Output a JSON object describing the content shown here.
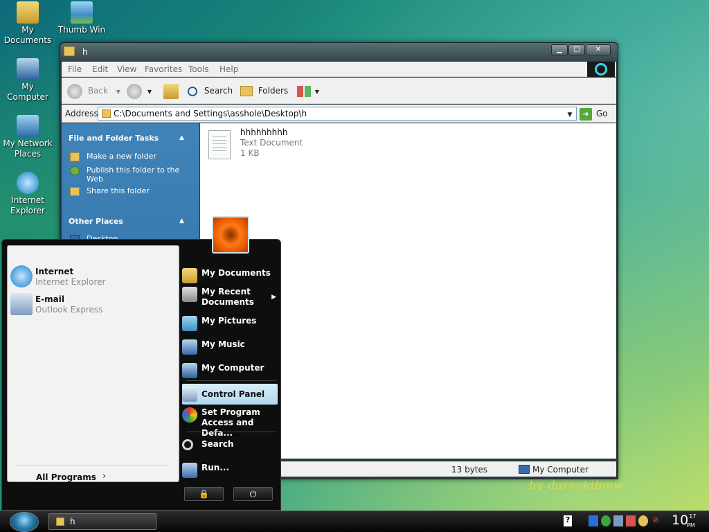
{
  "desktop": {
    "icons": [
      {
        "label": "My Documents",
        "icon": "folder-docs-icon"
      },
      {
        "label": "Thumb Win",
        "icon": "image-icon"
      },
      {
        "label": "My Computer",
        "icon": "computer-icon"
      },
      {
        "label": "My Network Places",
        "icon": "network-icon"
      },
      {
        "label": "Internet Explorer",
        "icon": "ie-icon"
      }
    ],
    "watermark": "by dareckibmw"
  },
  "explorer": {
    "title": "h",
    "menu": [
      "File",
      "Edit",
      "View",
      "Favorites",
      "Tools",
      "Help"
    ],
    "toolbar": {
      "back": "Back",
      "search": "Search",
      "folders": "Folders"
    },
    "address": {
      "label": "Address",
      "value": "C:\\Documents and Settings\\asshole\\Desktop\\h",
      "go": "Go"
    },
    "taskpane": {
      "file_tasks_title": "File and Folder Tasks",
      "file_tasks": [
        "Make a new folder",
        "Publish this folder to the Web",
        "Share this folder"
      ],
      "other_places_title": "Other Places",
      "other_places_first": "Desktop"
    },
    "file": {
      "name": "hhhhhhhhh",
      "type": "Text Document",
      "size": "1 KB"
    },
    "status": {
      "bytes": "13 bytes",
      "location": "My Computer"
    }
  },
  "startmenu": {
    "pinned": [
      {
        "title": "Internet",
        "subtitle": "Internet Explorer",
        "icon": "ie-icon"
      },
      {
        "title": "E-mail",
        "subtitle": "Outlook Express",
        "icon": "mail-icon"
      }
    ],
    "all_programs": "All Programs",
    "right": {
      "my_documents": "My Documents",
      "my_recent_documents": "My Recent Documents",
      "my_pictures": "My Pictures",
      "my_music": "My Music",
      "my_computer": "My Computer",
      "control_panel": "Control Panel",
      "set_program": "Set Program Access and Defa...",
      "search": "Search",
      "run": "Run..."
    }
  },
  "taskbar": {
    "task": "h",
    "clock_hour": "10",
    "clock_min": "17",
    "clock_ampm": "PM"
  },
  "colors": {
    "accent": "#3f83b8",
    "highlight": "#b0d8ee"
  }
}
